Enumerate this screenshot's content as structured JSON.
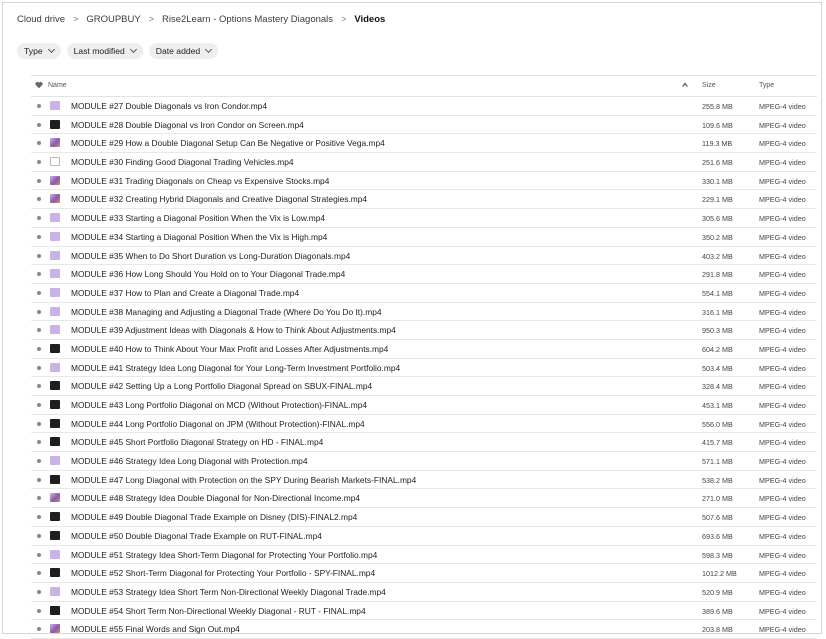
{
  "breadcrumb": [
    "Cloud drive",
    "GROUPBUY",
    "Rise2Learn - Options Mastery Diagonals",
    "Videos"
  ],
  "filters": [
    "Type",
    "Last modified",
    "Date added"
  ],
  "columns": {
    "name": "Name",
    "size": "Size",
    "type": "Type"
  },
  "thumb_colors": {
    "lavender": "#c9b3e6",
    "dark": "#1e1e1e",
    "face": "#8a5aa8",
    "blank": "#ffffff"
  },
  "files": [
    {
      "name": "MODULE #27 Double Diagonals vs Iron Condor.mp4",
      "size": "255.8 MB",
      "type": "MPEG-4 video",
      "thumb": "lavender"
    },
    {
      "name": "MODULE #28 Double Diagonal vs Iron Condor on Screen.mp4",
      "size": "109.6 MB",
      "type": "MPEG-4 video",
      "thumb": "dark"
    },
    {
      "name": "MODULE #29 How a Double Diagonal Setup Can Be Negative or Positive Vega.mp4",
      "size": "119.3 MB",
      "type": "MPEG-4 video",
      "thumb": "face"
    },
    {
      "name": "MODULE #30 Finding Good Diagonal Trading Vehicles.mp4",
      "size": "251.6 MB",
      "type": "MPEG-4 video",
      "thumb": "blank"
    },
    {
      "name": "MODULE #31 Trading Diagonals on Cheap vs Expensive Stocks.mp4",
      "size": "330.1 MB",
      "type": "MPEG-4 video",
      "thumb": "face"
    },
    {
      "name": "MODULE #32 Creating Hybrid Diagonals and Creative Diagonal Strategies.mp4",
      "size": "229.1 MB",
      "type": "MPEG-4 video",
      "thumb": "face"
    },
    {
      "name": "MODULE #33 Starting a Diagonal Position When the Vix is Low.mp4",
      "size": "305.6 MB",
      "type": "MPEG-4 video",
      "thumb": "lavender"
    },
    {
      "name": "MODULE #34 Starting a Diagonal Position When the Vix is High.mp4",
      "size": "350.2 MB",
      "type": "MPEG-4 video",
      "thumb": "lavender"
    },
    {
      "name": "MODULE #35 When to Do Short Duration vs Long-Duration Diagonals.mp4",
      "size": "403.2 MB",
      "type": "MPEG-4 video",
      "thumb": "lavender"
    },
    {
      "name": "MODULE #36 How Long Should You Hold on to Your Diagonal Trade.mp4",
      "size": "291.8 MB",
      "type": "MPEG-4 video",
      "thumb": "lavender"
    },
    {
      "name": "MODULE #37 How to Plan and Create a Diagonal Trade.mp4",
      "size": "554.1 MB",
      "type": "MPEG-4 video",
      "thumb": "lavender"
    },
    {
      "name": "MODULE #38 Managing and Adjusting a Diagonal Trade (Where Do You Do It).mp4",
      "size": "316.1 MB",
      "type": "MPEG-4 video",
      "thumb": "lavender"
    },
    {
      "name": "MODULE #39 Adjustment Ideas with Diagonals & How to Think About Adjustments.mp4",
      "size": "950.3 MB",
      "type": "MPEG-4 video",
      "thumb": "lavender"
    },
    {
      "name": "MODULE #40 How to Think About Your Max Profit and Losses After Adjustments.mp4",
      "size": "604.2 MB",
      "type": "MPEG-4 video",
      "thumb": "dark"
    },
    {
      "name": "MODULE #41 Strategy Idea Long Diagonal for Your Long-Term Investment Portfolio.mp4",
      "size": "503.4 MB",
      "type": "MPEG-4 video",
      "thumb": "lavender"
    },
    {
      "name": "MODULE #42 Setting Up a Long Portfolio Diagonal Spread on SBUX-FINAL.mp4",
      "size": "328.4 MB",
      "type": "MPEG-4 video",
      "thumb": "dark"
    },
    {
      "name": "MODULE #43 Long Portfolio Diagonal on MCD (Without Protection)-FINAL.mp4",
      "size": "453.1 MB",
      "type": "MPEG-4 video",
      "thumb": "dark"
    },
    {
      "name": "MODULE #44 Long Portfolio Diagonal on JPM (Without Protection)-FINAL.mp4",
      "size": "556.0 MB",
      "type": "MPEG-4 video",
      "thumb": "dark"
    },
    {
      "name": "MODULE #45 Short Portfolio Diagonal Strategy on HD - FINAL.mp4",
      "size": "415.7 MB",
      "type": "MPEG-4 video",
      "thumb": "dark"
    },
    {
      "name": "MODULE #46 Strategy Idea Long Diagonal with Protection.mp4",
      "size": "571.1 MB",
      "type": "MPEG-4 video",
      "thumb": "lavender"
    },
    {
      "name": "MODULE #47 Long Diagonal with Protection on the SPY During Bearish Markets-FINAL.mp4",
      "size": "538.2 MB",
      "type": "MPEG-4 video",
      "thumb": "dark"
    },
    {
      "name": "MODULE #48 Strategy Idea Double Diagonal for Non-Directional Income.mp4",
      "size": "271.0 MB",
      "type": "MPEG-4 video",
      "thumb": "face"
    },
    {
      "name": "MODULE #49 Double Diagonal Trade Example on Disney (DIS)-FINAL2.mp4",
      "size": "507.6 MB",
      "type": "MPEG-4 video",
      "thumb": "dark"
    },
    {
      "name": "MODULE #50 Double Diagonal Trade Example on RUT-FINAL.mp4",
      "size": "693.6 MB",
      "type": "MPEG-4 video",
      "thumb": "dark"
    },
    {
      "name": "MODULE #51 Strategy Idea Short-Term Diagonal for Protecting Your Portfolio.mp4",
      "size": "598.3 MB",
      "type": "MPEG-4 video",
      "thumb": "lavender"
    },
    {
      "name": "MODULE #52 Short-Term Diagonal for Protecting Your Portfolio - SPY-FINAL.mp4",
      "size": "1012.2 MB",
      "type": "MPEG-4 video",
      "thumb": "dark"
    },
    {
      "name": "MODULE #53 Strategy Idea Short Term Non-Directional Weekly Diagonal Trade.mp4",
      "size": "520.9 MB",
      "type": "MPEG-4 video",
      "thumb": "lavender"
    },
    {
      "name": "MODULE #54 Short Term Non-Directional Weekly Diagonal - RUT - FINAL.mp4",
      "size": "389.6 MB",
      "type": "MPEG-4 video",
      "thumb": "dark"
    },
    {
      "name": "MODULE #55 Final Words and Sign Out.mp4",
      "size": "203.8 MB",
      "type": "MPEG-4 video",
      "thumb": "face"
    }
  ]
}
